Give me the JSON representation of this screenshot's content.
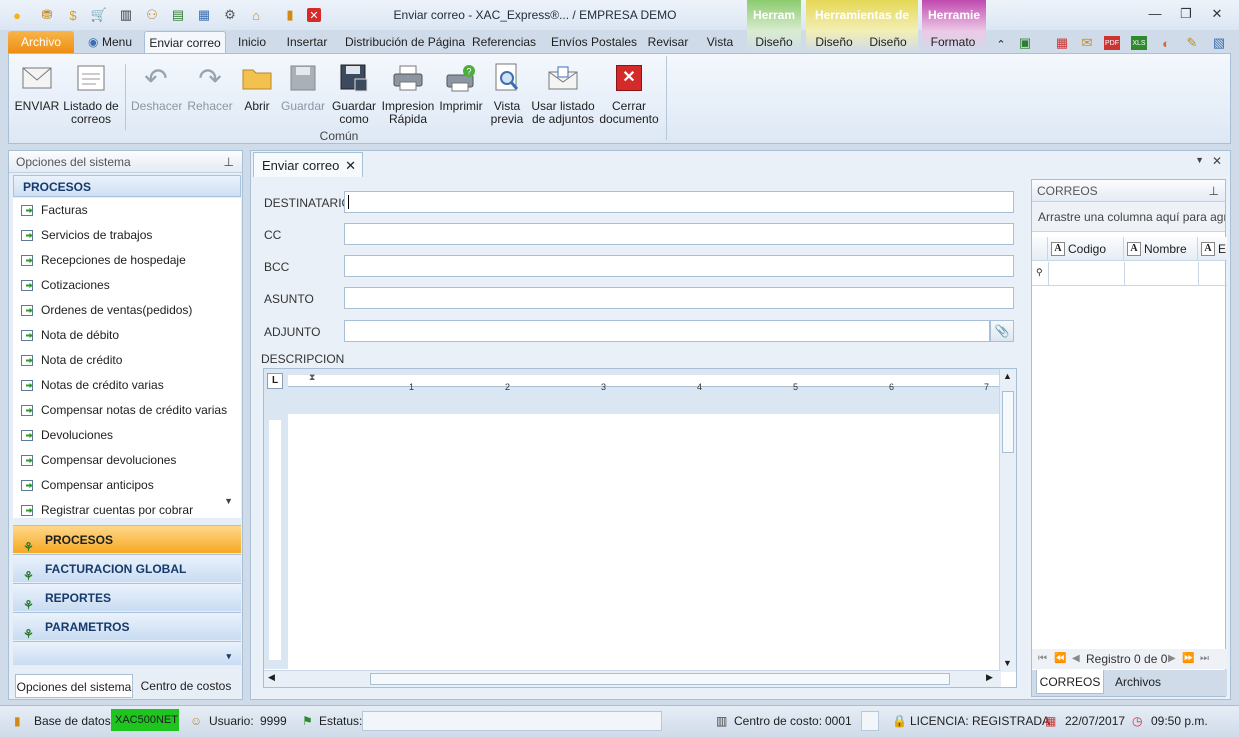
{
  "window": {
    "title": "Enviar correo - XAC_Express®... / EMPRESA DEMO",
    "context_tabs": [
      "Herram",
      "Herramientas de",
      "Herramie"
    ]
  },
  "ribbon_tabs": [
    "Archivo",
    "Menu",
    "Enviar correo",
    "Inicio",
    "Insertar",
    "Distribución de Página",
    "Referencias",
    "Envíos Postales",
    "Revisar",
    "Vista",
    "Diseño",
    "Diseño",
    "Diseño",
    "Formato"
  ],
  "ribbon_buttons": {
    "enviar": "ENVIAR",
    "listado1": "Listado de",
    "listado2": "correos",
    "deshacer": "Deshacer",
    "rehacer": "Rehacer",
    "abrir": "Abrir",
    "guardar": "Guardar",
    "guardar_como1": "Guardar",
    "guardar_como2": "como",
    "impresion1": "Impresion",
    "impresion2": "Rápida",
    "imprimir": "Imprimir",
    "vista1": "Vista",
    "vista2": "previa",
    "adjuntos1": "Usar listado",
    "adjuntos2": "de adjuntos",
    "cerrar1": "Cerrar",
    "cerrar2": "documento",
    "group_label": "Común"
  },
  "left_panel": {
    "title": "Opciones del sistema",
    "section": "PROCESOS",
    "items": [
      "Facturas",
      "Servicios de trabajos",
      "Recepciones de hospedaje",
      "Cotizaciones",
      "Ordenes de ventas(pedidos)",
      "Nota de débito",
      "Nota de crédito",
      "Notas de crédito varias",
      "Compensar notas de crédito varias",
      "Devoluciones",
      "Compensar devoluciones",
      "Compensar anticipos",
      "Registrar cuentas por cobrar"
    ],
    "nav": [
      "PROCESOS",
      "FACTURACION GLOBAL",
      "REPORTES",
      "PARAMETROS"
    ],
    "bottom_tabs": [
      "Opciones del sistema",
      "Centro de costos"
    ]
  },
  "document": {
    "tab": "Enviar correo",
    "fields": {
      "destinatario": "DESTINATARIO",
      "cc": "CC",
      "bcc": "BCC",
      "asunto": "ASUNTO",
      "adjunto": "ADJUNTO"
    },
    "descripcion": "DESCRIPCION",
    "ruler_numbers": [
      "1",
      "2",
      "3",
      "4",
      "5",
      "6",
      "7"
    ]
  },
  "correos_panel": {
    "title": "CORREOS",
    "group_hint": "Arrastre una columna aquí para agrupar",
    "columns": [
      "Codigo",
      "Nombre",
      "E"
    ],
    "nav_text": "Registro 0 de 0",
    "tabs": [
      "CORREOS",
      "Archivos"
    ]
  },
  "statusbar": {
    "db_label": "Base de datos:",
    "db_value": "XAC500NET",
    "user_label": "Usuario:",
    "user_value": "9999",
    "status_label": "Estatus:",
    "cost_label": "Centro de costo:",
    "cost_value": "0001",
    "license": "LICENCIA: REGISTRADA",
    "date": "22/07/2017",
    "time": "09:50 p.m."
  },
  "colors": {
    "accent_orange": "#f0961a",
    "db_green": "#1fc51f",
    "close_red": "#d42a2a"
  }
}
